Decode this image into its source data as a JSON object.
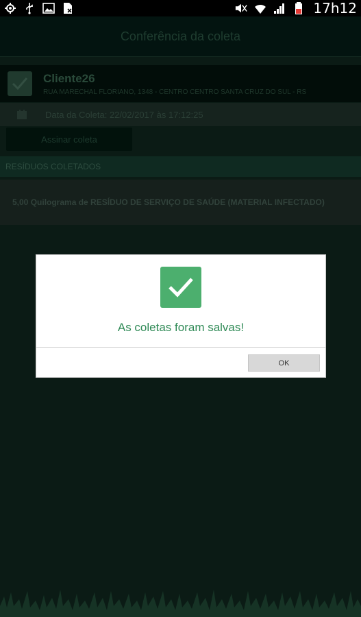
{
  "statusbar": {
    "time": "17h12",
    "left_icons": [
      "gps-icon",
      "usb-icon",
      "image-icon",
      "document-icon"
    ],
    "right_icons": [
      "mute-icon",
      "wifi-icon",
      "signal-icon",
      "battery-icon"
    ]
  },
  "toolbar": {
    "title": "Conferência da coleta"
  },
  "client": {
    "name": "Cliente26",
    "address": "RUA MARECHAL FLORIANO, 1348 - CENTRO CENTRO SANTA CRUZ DO SUL - RS"
  },
  "collection": {
    "date_text": "Data da Coleta: 22/02/2017 às 17:12:25",
    "assign_button": "Assinar coleta"
  },
  "residues": {
    "section_title": "RESÍDUOS COLETADOS",
    "items": [
      "5,00 Quilograma de RESÍDUO DE SERVIÇO DE SAÚDE (MATERIAL INFECTADO)"
    ]
  },
  "dialog": {
    "message": "As coletas foram salvas!",
    "ok_label": "OK"
  },
  "colors": {
    "accent_green": "#4caf6e",
    "message_text": "#2f8a56",
    "background": "#0b1b15"
  }
}
